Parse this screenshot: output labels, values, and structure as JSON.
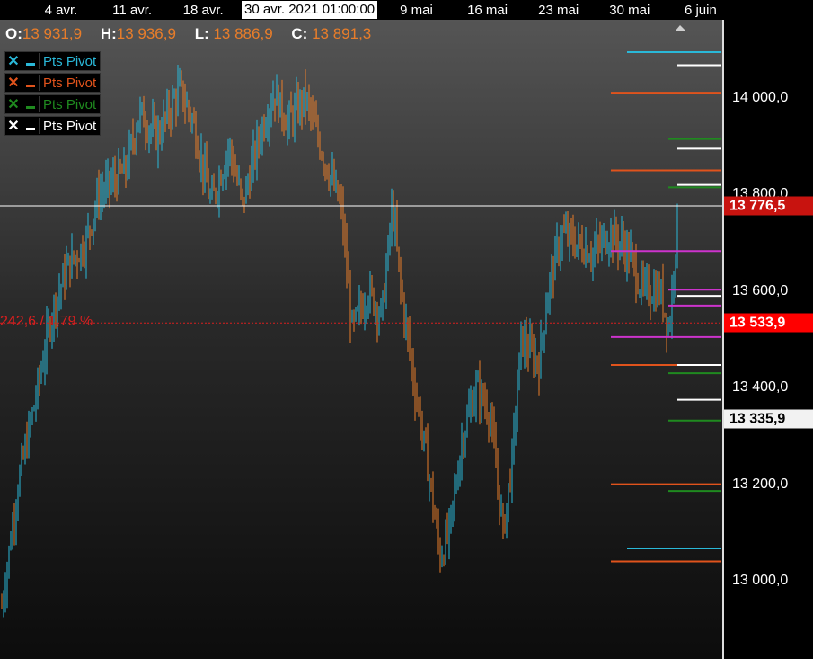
{
  "time_axis": {
    "labels": [
      {
        "text": "4 avr.",
        "date": "2021-04-04"
      },
      {
        "text": "11 avr.",
        "date": "2021-04-11"
      },
      {
        "text": "18 avr.",
        "date": "2021-04-18"
      },
      {
        "text": "9 mai",
        "date": "2021-05-09"
      },
      {
        "text": "16 mai",
        "date": "2021-05-16"
      },
      {
        "text": "23 mai",
        "date": "2021-05-23"
      },
      {
        "text": "30 mai",
        "date": "2021-05-30"
      },
      {
        "text": "6 juin",
        "date": "2021-06-06"
      }
    ],
    "cursor_label": "30 avr. 2021 01:00:00"
  },
  "ohlc": {
    "o_label": "O:",
    "o": "13 931,9",
    "h_label": "H:",
    "h": "13 936,9",
    "l_label": "L:",
    "l": "13 886,9",
    "c_label": "C:",
    "c": "13 891,3"
  },
  "legend": [
    {
      "label": "Pts Pivot",
      "color": "#2ab8d8"
    },
    {
      "label": "Pts Pivot",
      "color": "#e0531c"
    },
    {
      "label": "Pts Pivot",
      "color": "#1f8a1f"
    },
    {
      "label": "Pts Pivot",
      "color": "#ffffff"
    }
  ],
  "price_axis": {
    "ticks": [
      {
        "text": "14 000,0",
        "value": 14000
      },
      {
        "text": "13 800,0",
        "value": 13800
      },
      {
        "text": "13 600,0",
        "value": 13600
      },
      {
        "text": "13 400,0",
        "value": 13400
      },
      {
        "text": "13 200,0",
        "value": 13200
      },
      {
        "text": "13 000,0",
        "value": 13000
      }
    ],
    "badges": [
      {
        "text": "13 776,5",
        "value": 13776.5,
        "bg": "#c8130f",
        "fg": "#ffffff"
      },
      {
        "text": "13 533,9",
        "value": 13533.9,
        "bg": "#ff0000",
        "fg": "#ffffff"
      },
      {
        "text": "13 335,9",
        "value": 13335.9,
        "bg": "#f2f2f2",
        "fg": "#000000"
      }
    ]
  },
  "measure_label": "242,6 / 1,79 %",
  "chart_data": {
    "type": "bar",
    "subtype": "ohlc-price-bars",
    "y_range": [
      12900,
      14130
    ],
    "colors": {
      "up": "#2ab8d8",
      "down": "#e87d2a"
    },
    "crosshair_price": 13776.5,
    "reference_price": 13533.9,
    "pivot_levels": [
      {
        "value": 14095,
        "color": "#2ab8d8"
      },
      {
        "value": 14068,
        "color": "#ffffff"
      },
      {
        "value": 14011,
        "color": "#e0531c"
      },
      {
        "value": 13915,
        "color": "#1f8a1f"
      },
      {
        "value": 13895,
        "color": "#ffffff"
      },
      {
        "value": 13850,
        "color": "#e0531c"
      },
      {
        "value": 13815,
        "color": "#1f8a1f"
      },
      {
        "value": 13820,
        "color": "#ffffff"
      },
      {
        "value": 13683,
        "color": "#cc33cc"
      },
      {
        "value": 13603,
        "color": "#cc33cc"
      },
      {
        "value": 13590,
        "color": "#ffffff"
      },
      {
        "value": 13570,
        "color": "#cc33cc"
      },
      {
        "value": 13505,
        "color": "#cc33cc"
      },
      {
        "value": 13447,
        "color": "#e0531c"
      },
      {
        "value": 13447,
        "color": "#ffffff"
      },
      {
        "value": 13430,
        "color": "#1f8a1f"
      },
      {
        "value": 13375,
        "color": "#ffffff"
      },
      {
        "value": 13332,
        "color": "#1f8a1f"
      },
      {
        "value": 13200,
        "color": "#e0531c"
      },
      {
        "value": 13186,
        "color": "#1f8a1f"
      },
      {
        "value": 13067,
        "color": "#2ab8d8"
      },
      {
        "value": 13040,
        "color": "#e0531c"
      }
    ],
    "path_keyframes": [
      [
        0,
        12920
      ],
      [
        20,
        13200
      ],
      [
        40,
        13380
      ],
      [
        57,
        13550
      ],
      [
        75,
        13650
      ],
      [
        95,
        13700
      ],
      [
        110,
        13800
      ],
      [
        140,
        13850
      ],
      [
        155,
        13970
      ],
      [
        175,
        13920
      ],
      [
        200,
        14020
      ],
      [
        215,
        13950
      ],
      [
        235,
        13780
      ],
      [
        255,
        13900
      ],
      [
        270,
        13780
      ],
      [
        290,
        13930
      ],
      [
        305,
        14010
      ],
      [
        320,
        13950
      ],
      [
        340,
        14000
      ],
      [
        360,
        13880
      ],
      [
        380,
        13770
      ],
      [
        392,
        13520
      ],
      [
        410,
        13600
      ],
      [
        425,
        13550
      ],
      [
        437,
        13780
      ],
      [
        445,
        13620
      ],
      [
        460,
        13420
      ],
      [
        475,
        13250
      ],
      [
        490,
        13050
      ],
      [
        500,
        13100
      ],
      [
        515,
        13300
      ],
      [
        530,
        13400
      ],
      [
        545,
        13350
      ],
      [
        560,
        13100
      ],
      [
        570,
        13250
      ],
      [
        580,
        13500
      ],
      [
        600,
        13450
      ],
      [
        610,
        13600
      ],
      [
        625,
        13720
      ],
      [
        640,
        13700
      ],
      [
        660,
        13680
      ],
      [
        680,
        13720
      ],
      [
        700,
        13680
      ],
      [
        715,
        13600
      ],
      [
        735,
        13600
      ],
      [
        745,
        13520
      ],
      [
        750,
        13650
      ],
      [
        755,
        13770
      ]
    ]
  }
}
